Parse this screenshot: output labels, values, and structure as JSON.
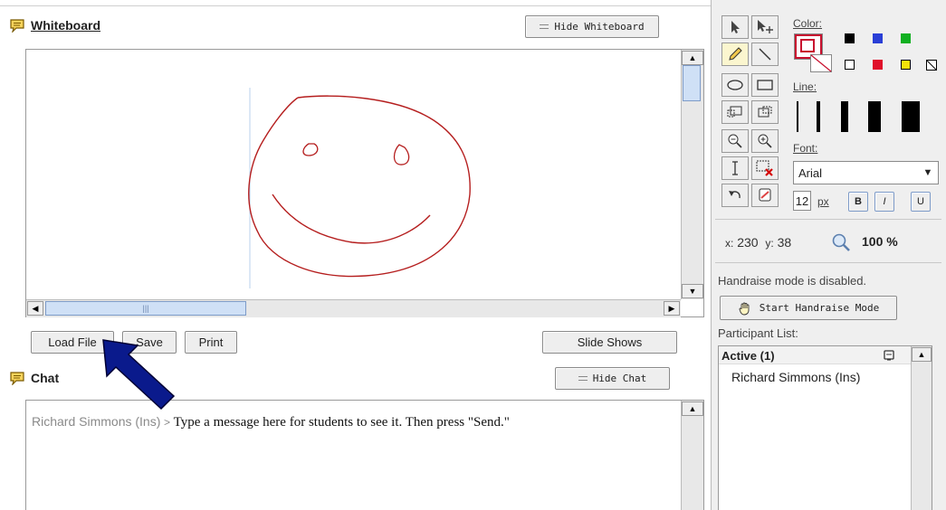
{
  "whiteboard": {
    "title": "Whiteboard",
    "hide_label": "Hide Whiteboard"
  },
  "board_buttons": {
    "load": "Load File",
    "save": "Save",
    "print": "Print",
    "slides": "Slide Shows"
  },
  "chat": {
    "title": "Chat",
    "hide_label": "Hide Chat",
    "sender": "Richard Simmons (Ins)",
    "separator": ">",
    "message": "Type a message here for students to see it.  Then press \"Send.\""
  },
  "tools": {
    "color_label": "Color:",
    "line_label": "Line:",
    "font_label": "Font:",
    "font_name": "Arial",
    "font_size": "12",
    "font_unit": "px",
    "bold": "B",
    "italic": "I",
    "underline": "U",
    "colors": [
      "#000000",
      "#2a3fd6",
      "#11b021",
      "#ffffff",
      "#e0102a",
      "#f4e10a"
    ],
    "selected_color": "#c8102e"
  },
  "status": {
    "x_label": "x:",
    "x_value": "230",
    "y_label": "y:",
    "y_value": "38",
    "zoom": "100 %"
  },
  "handraise": {
    "status_text": "Handraise mode is disabled.",
    "button_label": "Start Handraise Mode"
  },
  "participants": {
    "label": "Participant List:",
    "active_header": "Active (1)",
    "items": [
      "Richard Simmons (Ins)"
    ]
  }
}
